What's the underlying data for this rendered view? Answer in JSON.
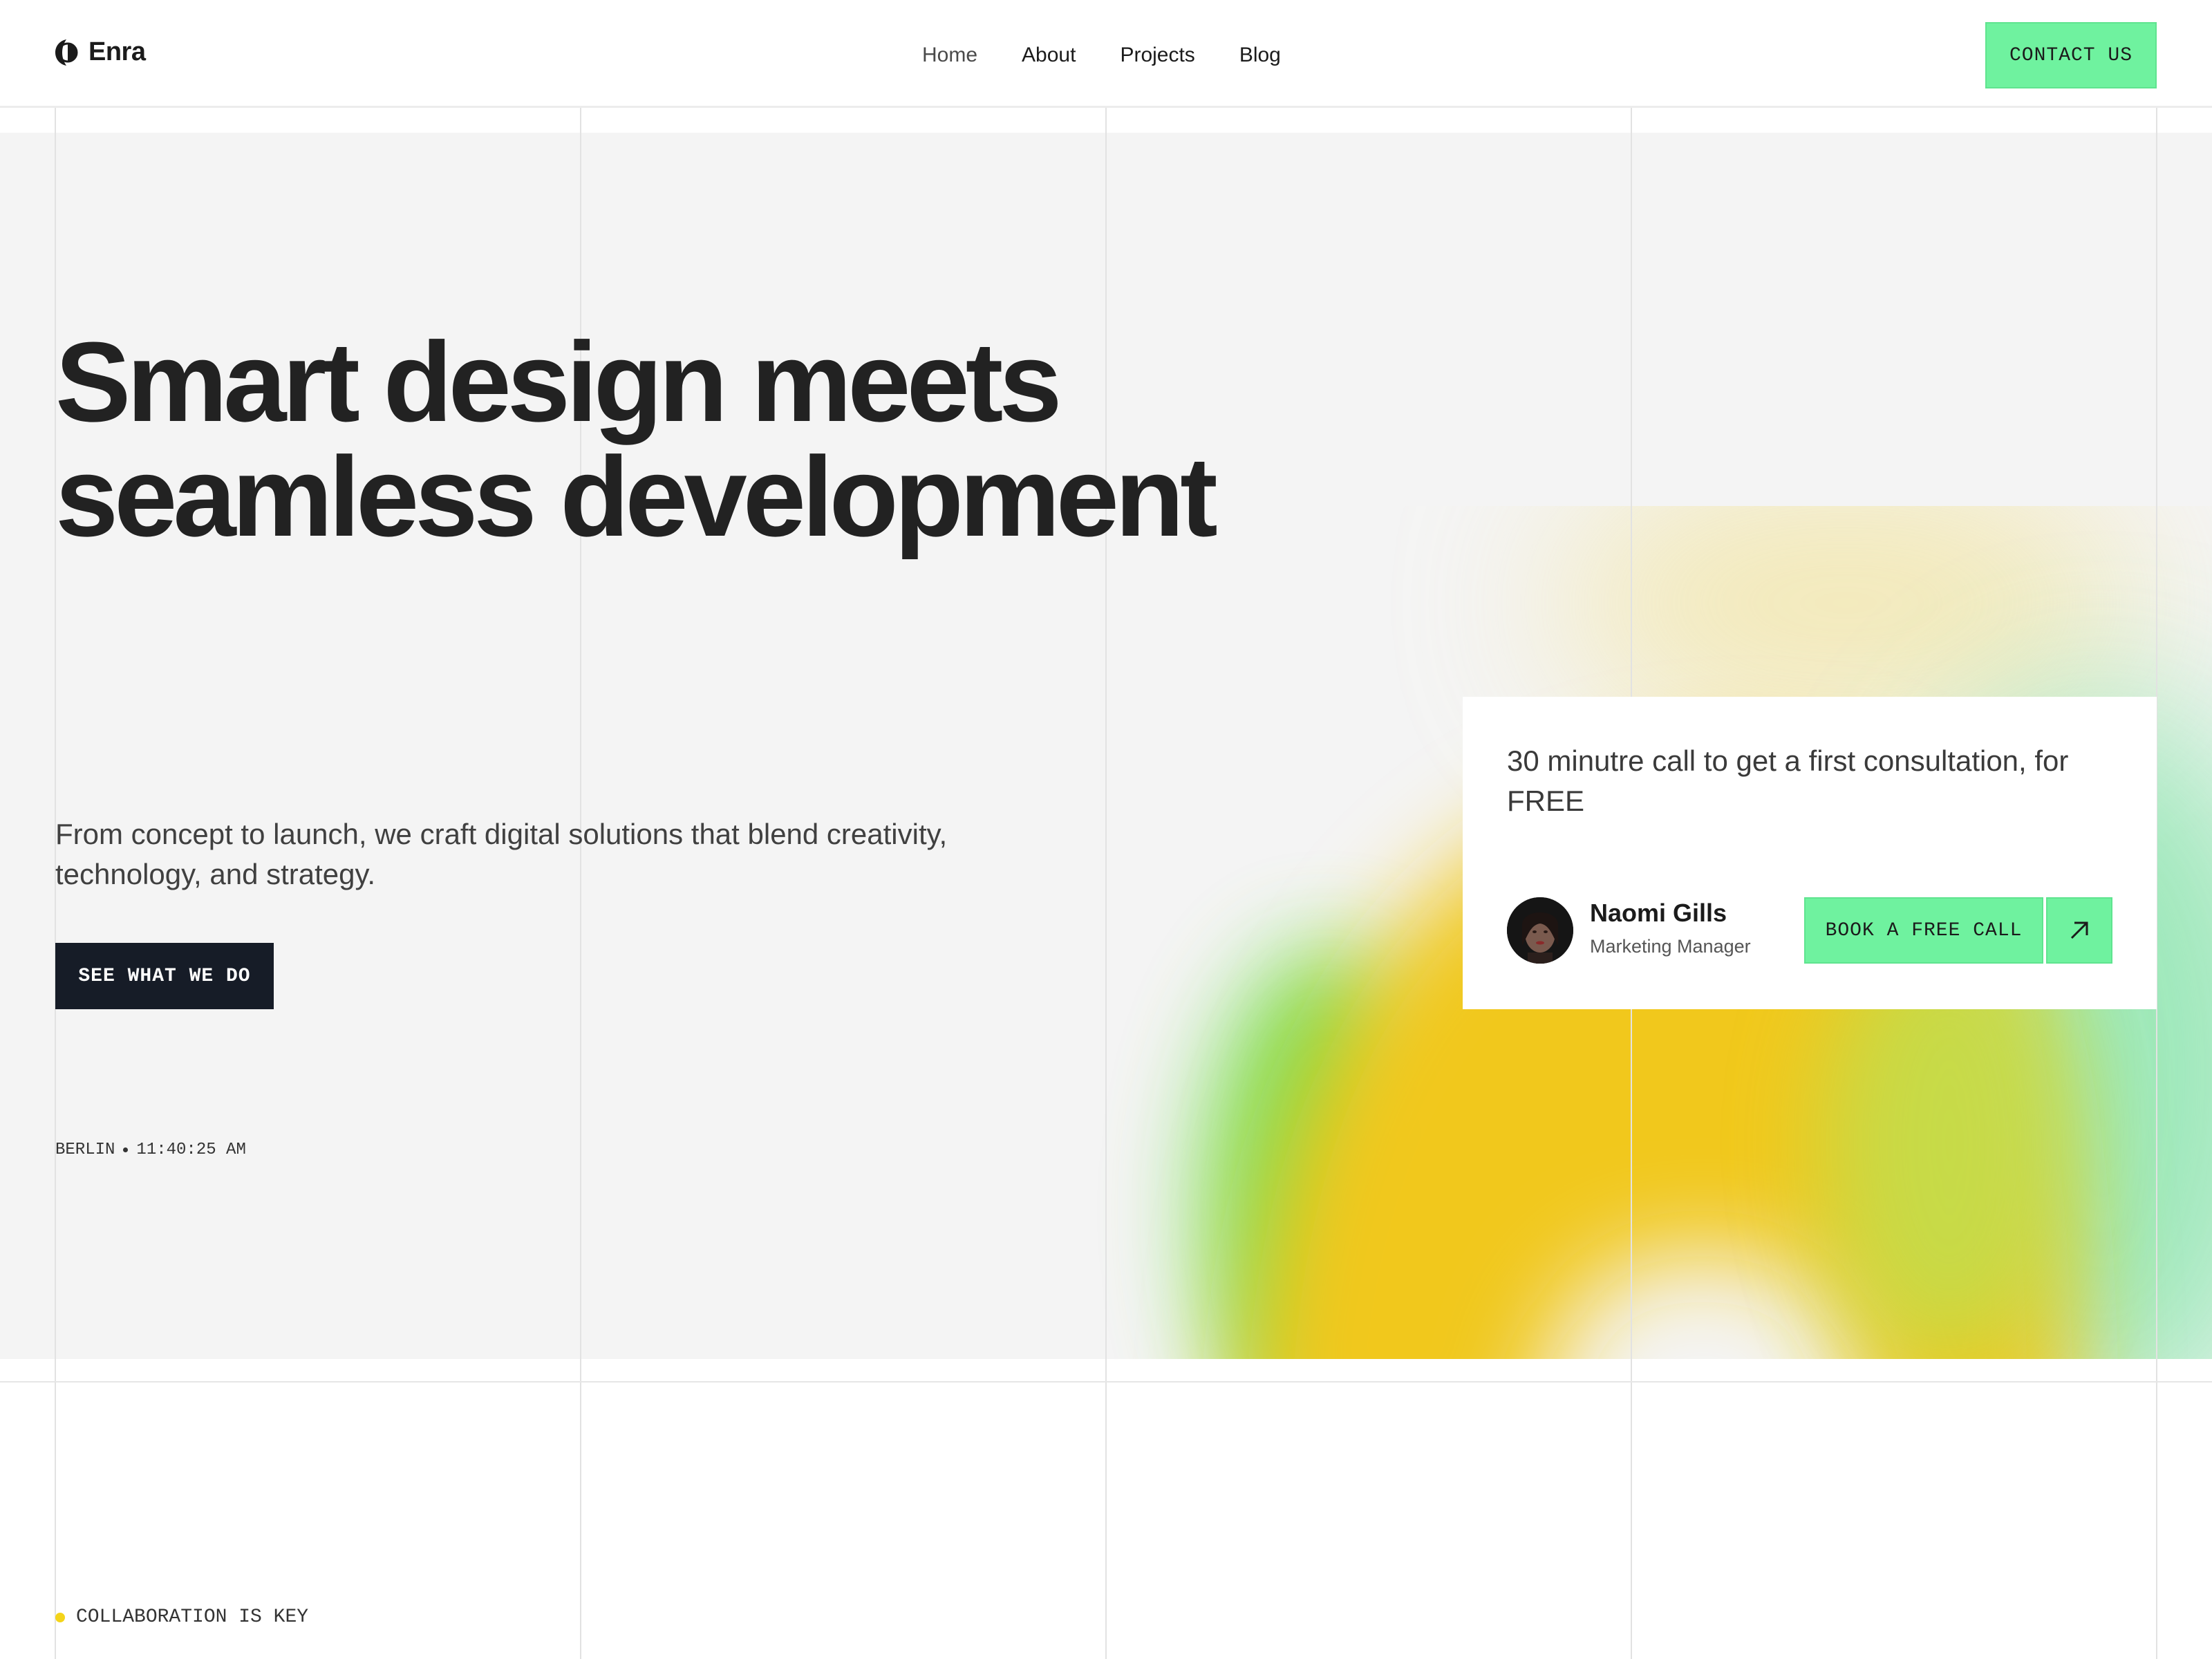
{
  "header": {
    "brand": "Enra",
    "nav": [
      {
        "label": "Home",
        "active": true
      },
      {
        "label": "About",
        "active": false
      },
      {
        "label": "Projects",
        "active": false
      },
      {
        "label": "Blog",
        "active": false
      }
    ],
    "contact_label": "CONTACT US"
  },
  "hero": {
    "headline_line1": "Smart design meets",
    "headline_line2": "seamless development",
    "subtext": "From concept to launch, we craft digital solutions that blend creativity, technology, and strategy.",
    "cta_label": "SEE WHAT WE DO",
    "location": "BERLIN",
    "time": "11:40:25 AM"
  },
  "consult_card": {
    "text": "30 minutre call to get a first consultation, for FREE",
    "person_name": "Naomi Gills",
    "person_role": "Marketing Manager",
    "book_label": "BOOK A FREE CALL"
  },
  "section_tag": "COLLABORATION IS KEY",
  "colors": {
    "accent_green": "#6ff29f",
    "dark_button": "#161c27",
    "hero_bg": "#f4f4f4",
    "blob_yellow": "#f1c81e",
    "blob_green": "#6fdc4a"
  }
}
